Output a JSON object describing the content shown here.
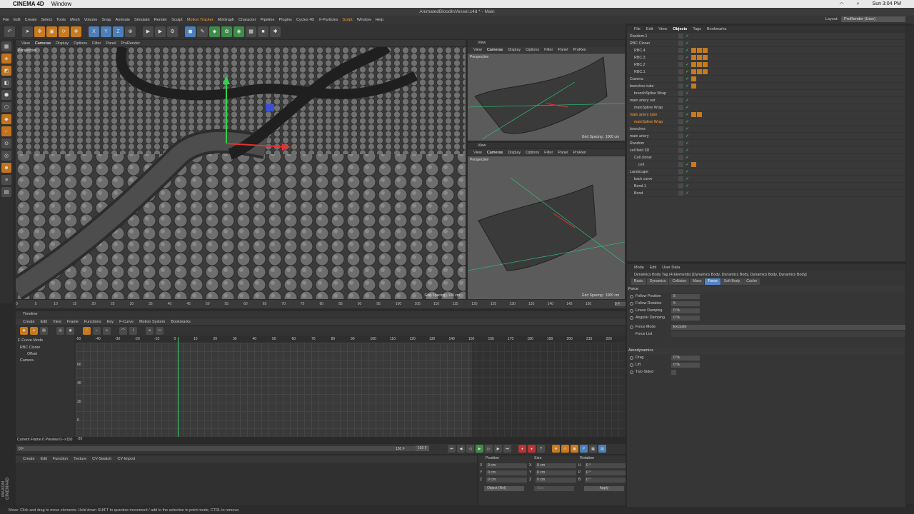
{
  "mac": {
    "apple": "",
    "app": "CINEMA 4D",
    "window": "Window",
    "time": "Sun 3:04 PM"
  },
  "title": "AnimatedBloodInVessel.c4d * - Main",
  "menu": [
    "File",
    "Edit",
    "Create",
    "Select",
    "Tools",
    "Mesh",
    "Volume",
    "Snap",
    "Animate",
    "Simulate",
    "Render",
    "Sculpt",
    "Motion Tracker",
    "MoGraph",
    "Character",
    "Pipeline",
    "Plugins",
    "Cycles 4D",
    "X-Particles",
    "Script",
    "Window",
    "Help"
  ],
  "layout": {
    "label": "Layout:",
    "value": "ProRender (User)"
  },
  "toolbar": {
    "x": "X",
    "y": "Y",
    "z": "Z"
  },
  "vp_main": {
    "menu": [
      "View",
      "Cameras",
      "Display",
      "Options",
      "Filter",
      "Panel",
      "ProRender"
    ],
    "persp": "Perspective",
    "grid": "Grid Spacing : 100 cm"
  },
  "vp_top": {
    "title": "View",
    "menu": [
      "View",
      "Cameras",
      "Display",
      "Options",
      "Filter",
      "Panel",
      "ProRen"
    ],
    "persp": "Perspective",
    "grid": "Grid Spacing : 1000 cm"
  },
  "vp_bot": {
    "title": "View",
    "menu": [
      "View",
      "Cameras",
      "Display",
      "Options",
      "Filter",
      "Panel",
      "ProRen"
    ],
    "persp": "Perspective",
    "grid": "Grid Spacing : 1000 cm"
  },
  "ruler": [
    "0",
    "5",
    "10",
    "15",
    "20",
    "25",
    "30",
    "35",
    "40",
    "45",
    "50",
    "55",
    "60",
    "65",
    "70",
    "75",
    "80",
    "85",
    "90",
    "95",
    "100",
    "105",
    "110",
    "115",
    "120",
    "125",
    "130",
    "135",
    "140",
    "145",
    "150"
  ],
  "ruler_end": "0 F",
  "timeline": {
    "title": "Timeline",
    "menu": [
      "Create",
      "Edit",
      "View",
      "Frame",
      "Functions",
      "Key",
      "F-Curve",
      "Motion System",
      "Bookmarks"
    ],
    "mode": "F-Curve Mode",
    "tree": [
      "RBC Cloner",
      "Offset",
      "Camera"
    ],
    "nums": [
      "-50",
      "-40",
      "-30",
      "-20",
      "-10",
      "0",
      "10",
      "20",
      "30",
      "40",
      "50",
      "60",
      "70",
      "80",
      "90",
      "100",
      "110",
      "120",
      "130",
      "140",
      "150",
      "160",
      "170",
      "180",
      "190",
      "200",
      "210",
      "220"
    ],
    "yvals": [
      "60",
      "40",
      "20",
      "0",
      "-20"
    ],
    "current": "Current Frame  0  Preview  0-->150"
  },
  "play": {
    "start": "0 F",
    "end1": "150 F",
    "end2": "150 F"
  },
  "matmgr": {
    "menu": [
      "Create",
      "Edit",
      "Function",
      "Texture",
      "CV-Swatch",
      "CV-Import"
    ]
  },
  "coord": {
    "h1": "Position",
    "h2": "Size",
    "h3": "Rotation",
    "rows": [
      [
        "X",
        "0 cm",
        "X",
        "0 cm",
        "H",
        "0 °"
      ],
      [
        "Y",
        "0 cm",
        "Y",
        "0 cm",
        "P",
        "0 °"
      ],
      [
        "Z",
        "0 cm",
        "Z",
        "0 cm",
        "B",
        "0 °"
      ]
    ],
    "obj": "Object (Rel)",
    "size": "Size",
    "apply": "Apply"
  },
  "status": "Move: Click and drag to move elements. Hold down SHIFT to quantize movement / add to the selection in point mode, CTRL to remove.",
  "logo": "MAXON CINEMA4D",
  "objmgr": {
    "menu": [
      "File",
      "Edit",
      "View",
      "Objects",
      "Tags",
      "Bookmarks"
    ],
    "rows": [
      "Random.1",
      "RBC Cloner",
      "RBC.4",
      "RBC.3",
      "RBC.2",
      "RBC.1",
      "Camera",
      "branches tube",
      "branchSpline Wrap",
      "main artery out",
      "mainSpline Wrap",
      "main artery tube",
      "mainSpline Wrap",
      "branches",
      "main artery",
      "Random",
      "cell field 3D",
      "Cell cloner",
      "cell",
      "Landscape",
      "back curve",
      "Bend.1",
      "Bend"
    ]
  },
  "attr": {
    "menu": [
      "Mode",
      "Edit",
      "User Data"
    ],
    "title": "Dynamics Body Tag (4 Elements) [Dynamics Body, Dynamics Body, Dynamics Body, Dynamics Body]",
    "tabs": [
      "Basic",
      "Dynamics",
      "Collision",
      "Mass",
      "Force",
      "Soft Body",
      "Cache"
    ],
    "force": "Force",
    "p1": [
      "Follow Position",
      "5"
    ],
    "p2": [
      "Follow Rotation",
      "5"
    ],
    "p3": [
      "Linear Damping",
      "0 %"
    ],
    "p4": [
      "Angular Damping",
      "0 %"
    ],
    "p5": [
      "Force Mode",
      "Exclude"
    ],
    "p6": [
      "Force List",
      ""
    ],
    "aero": "Aerodynamics",
    "a1": [
      "Drag",
      "0 %"
    ],
    "a2": [
      "Lift",
      "0 %"
    ],
    "a3": [
      "Two-Sided",
      ""
    ]
  }
}
